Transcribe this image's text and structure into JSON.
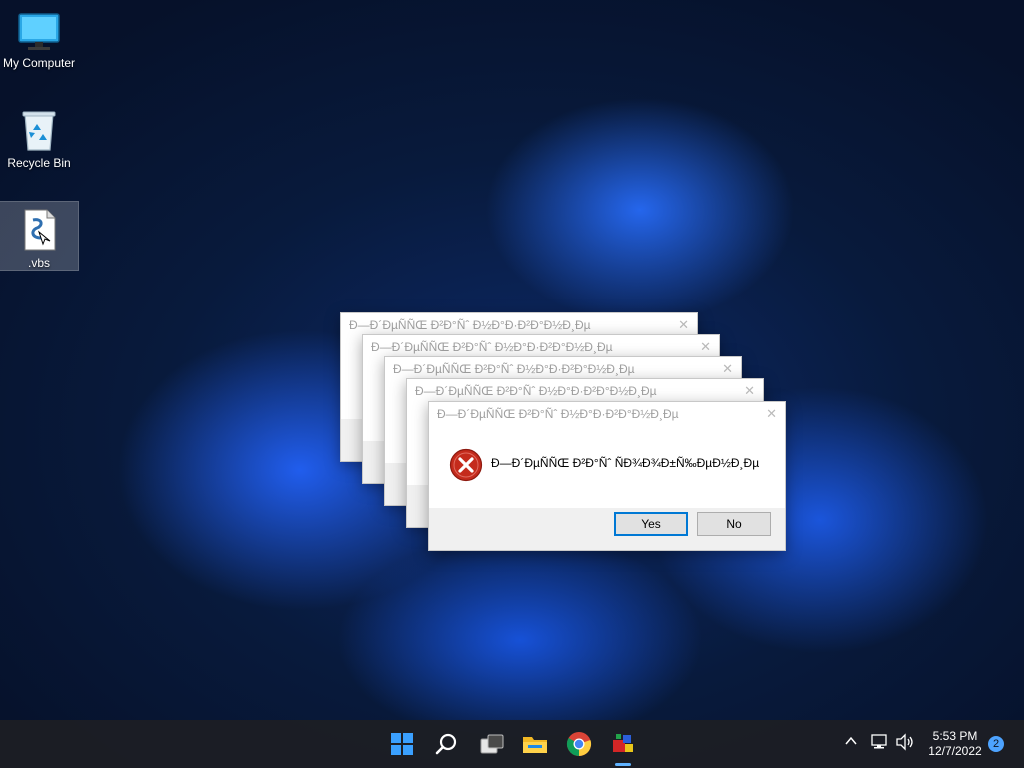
{
  "desktop": {
    "icons": [
      {
        "label": "My Computer",
        "icon": "monitor-icon"
      },
      {
        "label": "Recycle Bin",
        "icon": "recycle-bin-icon"
      },
      {
        "label": ".vbs",
        "icon": "vbs-script-icon"
      }
    ]
  },
  "dialogs": {
    "stacked_titles": [
      "Ð—Ð´ÐµÑÑŒ Ð²Ð°Ñˆ Ð½Ð°Ð·Ð²Ð°Ð½Ð¸Ðµ",
      "Ð—Ð´ÐµÑÑŒ Ð²Ð°Ñˆ Ð½Ð°Ð·Ð²Ð°Ð½Ð¸Ðµ",
      "Ð—Ð´ÐµÑÑŒ Ð²Ð°Ñˆ Ð½Ð°Ð·Ð²Ð°Ð½Ð¸Ðµ",
      "Ð—Ð´ÐµÑÑŒ Ð²Ð°Ñˆ Ð½Ð°Ð·Ð²Ð°Ð½Ð¸Ðµ"
    ],
    "front": {
      "title": "Ð—Ð´ÐµÑÑŒ Ð²Ð°Ñˆ Ð½Ð°Ð·Ð²Ð°Ð½Ð¸Ðµ",
      "message": "Ð—Ð´ÐµÑÑŒ Ð²Ð°Ñˆ ÑÐ¾Ð¾Ð±Ñ‰ÐµÐ½Ð¸Ðµ",
      "yes_label": "Yes",
      "no_label": "No",
      "icon": "error-icon"
    }
  },
  "taskbar": {
    "icons": [
      "start-icon",
      "search-icon",
      "task-view-icon",
      "file-explorer-icon",
      "chrome-icon",
      "app-icon"
    ],
    "tray": {
      "time": "5:53 PM",
      "date": "12/7/2022",
      "notification_count": "2"
    }
  },
  "colors": {
    "accent": "#0078d4",
    "error_red": "#c42b1c"
  }
}
